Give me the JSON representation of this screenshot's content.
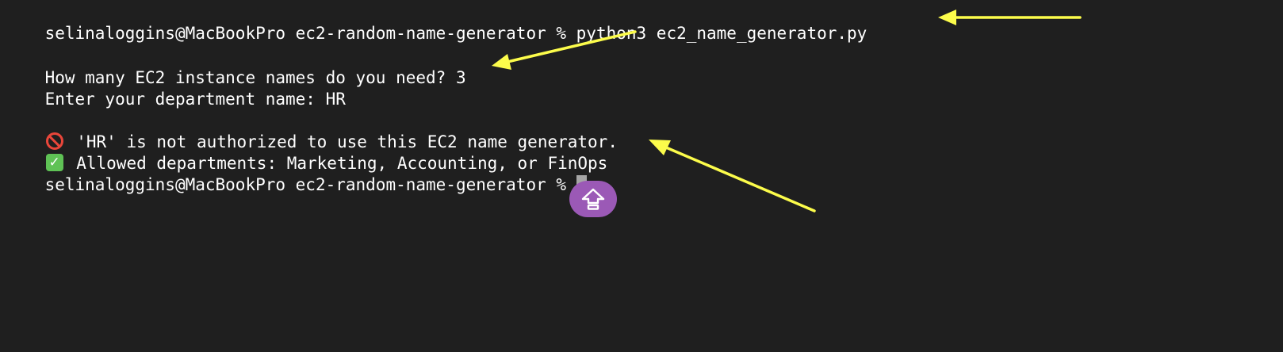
{
  "terminal": {
    "colors": {
      "background": "#1f1f1f",
      "text": "#ffffff",
      "cursor": "#a6a6a6",
      "prohibited_icon": "#e9463a",
      "check_icon": "#5fc255",
      "floating_button": "#9b59b6",
      "annotation_arrows": "#fcfc4b"
    },
    "lines": {
      "command": "selinaloggins@MacBookPro ec2-random-name-generator % python3 ec2_name_generator.py",
      "count_prompt": "How many EC2 instance names do you need? 3",
      "department_prompt": "Enter your department name: HR",
      "error_message": "'HR' is not authorized to use this EC2 name generator.",
      "allowed_message": "Allowed departments: Marketing, Accounting, or FinOps",
      "final_prompt": "selinaloggins@MacBookPro ec2-random-name-generator % "
    },
    "icons": {
      "error": "prohibited-icon",
      "allowed": "check-mark-button-icon",
      "floating": "shift-arrow-up-icon"
    },
    "check_glyph": "✓"
  }
}
